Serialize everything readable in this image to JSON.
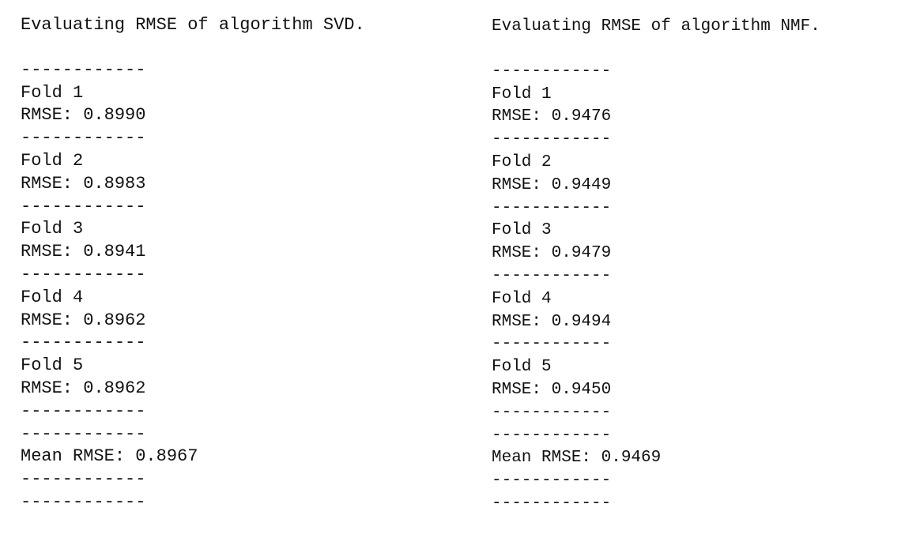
{
  "svd": {
    "header": "Evaluating RMSE of algorithm SVD.",
    "separator": "------------",
    "folds": [
      {
        "label": "Fold 1",
        "rmse": "RMSE: 0.8990"
      },
      {
        "label": "Fold 2",
        "rmse": "RMSE: 0.8983"
      },
      {
        "label": "Fold 3",
        "rmse": "RMSE: 0.8941"
      },
      {
        "label": "Fold 4",
        "rmse": "RMSE: 0.8962"
      },
      {
        "label": "Fold 5",
        "rmse": "RMSE: 0.8962"
      }
    ],
    "mean": "Mean RMSE: 0.8967"
  },
  "nmf": {
    "header": "Evaluating RMSE of algorithm NMF.",
    "separator": "------------",
    "folds": [
      {
        "label": "Fold 1",
        "rmse": "RMSE: 0.9476"
      },
      {
        "label": "Fold 2",
        "rmse": "RMSE: 0.9449"
      },
      {
        "label": "Fold 3",
        "rmse": "RMSE: 0.9479"
      },
      {
        "label": "Fold 4",
        "rmse": "RMSE: 0.9494"
      },
      {
        "label": "Fold 5",
        "rmse": "RMSE: 0.9450"
      }
    ],
    "mean": "Mean RMSE: 0.9469"
  }
}
